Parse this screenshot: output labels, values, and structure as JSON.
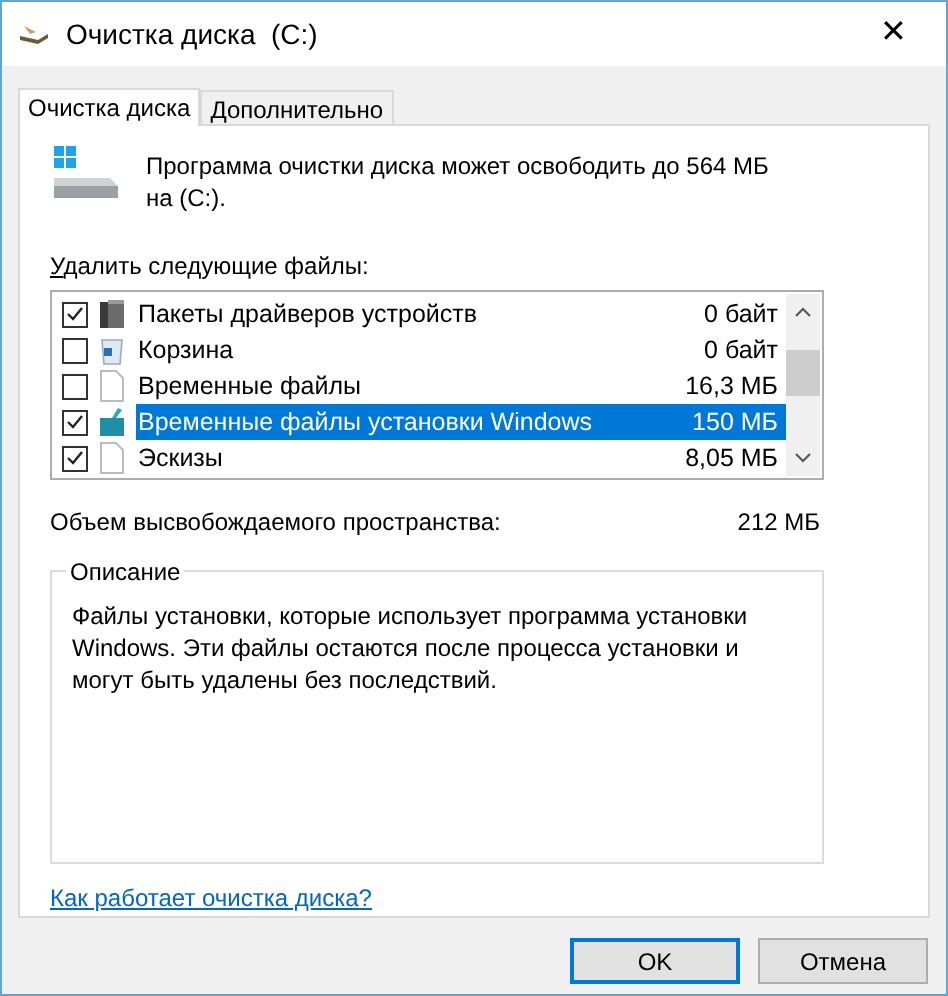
{
  "window": {
    "title": "Очистка диска  (C:)",
    "close": "✕"
  },
  "tabs": [
    {
      "label": "Очистка диска",
      "selected": true
    },
    {
      "label": "Дополнительно",
      "selected": false
    }
  ],
  "summary": "Программа очистки диска может освободить до 564 МБ на (C:).",
  "files_label": "Удалить следующие файлы:",
  "files": [
    {
      "name": "Пакеты драйверов устройств",
      "size": "0 байт",
      "checked": true,
      "selected": false,
      "kind": "driver"
    },
    {
      "name": "Корзина",
      "size": "0 байт",
      "checked": false,
      "selected": false,
      "kind": "recycle"
    },
    {
      "name": "Временные файлы",
      "size": "16,3 МБ",
      "checked": false,
      "selected": false,
      "kind": "file"
    },
    {
      "name": "Временные файлы установки Windows",
      "size": "150 МБ",
      "checked": true,
      "selected": true,
      "kind": "setup"
    },
    {
      "name": "Эскизы",
      "size": "8,05 МБ",
      "checked": true,
      "selected": false,
      "kind": "file"
    }
  ],
  "space": {
    "label": "Объем высвобождаемого пространства:",
    "value": "212 МБ"
  },
  "description": {
    "title": "Описание",
    "text": "Файлы установки, которые использует программа установки Windows.  Эти файлы остаются после процесса установки и могут быть удалены без последствий."
  },
  "help_link": "Как работает очистка диска?",
  "buttons": [
    {
      "label": "OK",
      "default": true
    },
    {
      "label": "Отмена",
      "default": false
    }
  ]
}
